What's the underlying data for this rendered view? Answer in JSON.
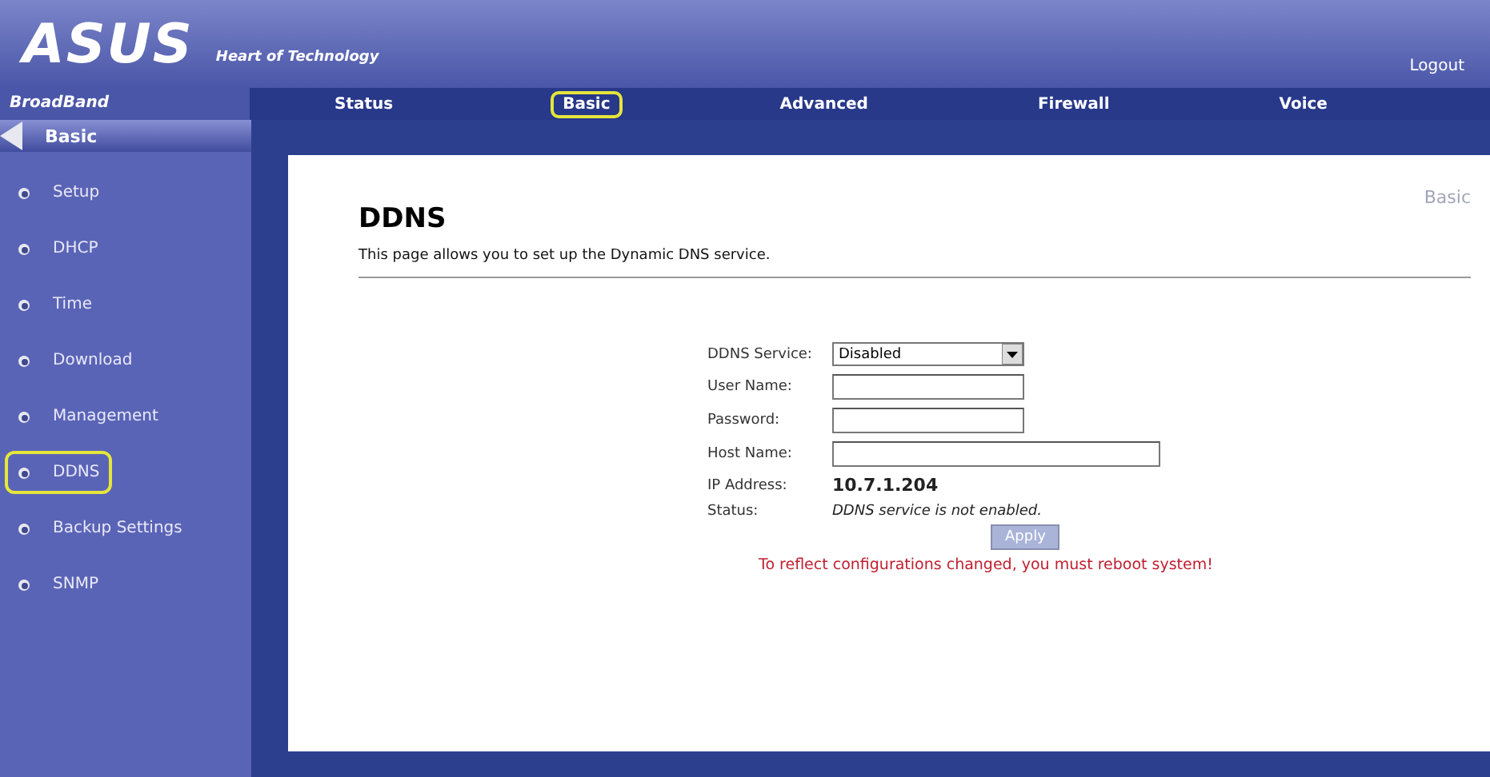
{
  "header": {
    "brand": "ASUS",
    "tagline": "Heart of Technology",
    "logout": "Logout",
    "product": "BroadBand"
  },
  "tabs": [
    {
      "label": "Status",
      "selected": false
    },
    {
      "label": "Basic",
      "selected": true
    },
    {
      "label": "Advanced",
      "selected": false
    },
    {
      "label": "Firewall",
      "selected": false
    },
    {
      "label": "Voice",
      "selected": false
    }
  ],
  "sidebar": {
    "title": "Basic",
    "items": [
      {
        "label": "Setup",
        "selected": false
      },
      {
        "label": "DHCP",
        "selected": false
      },
      {
        "label": "Time",
        "selected": false
      },
      {
        "label": "Download",
        "selected": false
      },
      {
        "label": "Management",
        "selected": false
      },
      {
        "label": "DDNS",
        "selected": true
      },
      {
        "label": "Backup Settings",
        "selected": false
      },
      {
        "label": "SNMP",
        "selected": false
      }
    ]
  },
  "page": {
    "title": "DDNS",
    "section": "Basic",
    "description": "This page allows you to set up the Dynamic DNS service.",
    "fields": [
      {
        "kind": "select",
        "label": "DDNS Service:",
        "value": "Disabled"
      },
      {
        "kind": "input",
        "label": "User Name:"
      },
      {
        "kind": "input",
        "label": "Password:"
      },
      {
        "kind": "wide-input",
        "label": "Host Name:"
      },
      {
        "kind": "bold-text",
        "label": "IP Address:",
        "value": "10.7.1.204"
      },
      {
        "kind": "italic-text",
        "label": "Status:",
        "value": "DDNS service is not enabled."
      }
    ],
    "apply": "Apply",
    "warning": "To reflect configurations changed, you must reboot system!"
  }
}
